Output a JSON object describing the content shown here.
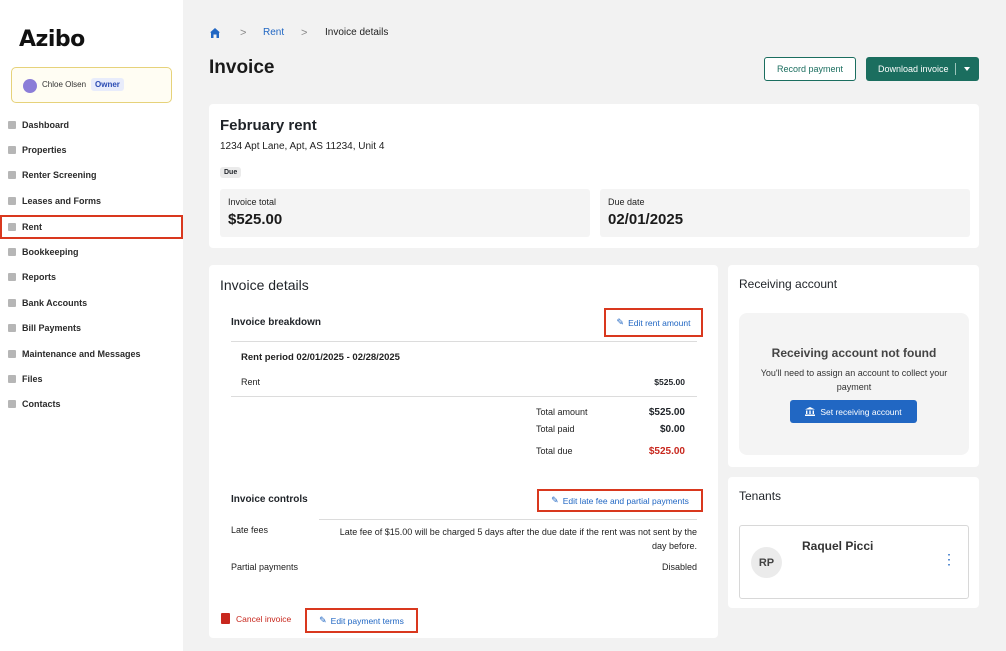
{
  "app": {
    "logo": "Azibo"
  },
  "user": {
    "name": "Chloe Olsen",
    "role": "Owner"
  },
  "sidebar": {
    "items": [
      {
        "label": "Dashboard",
        "icon": "home-icon"
      },
      {
        "label": "Properties",
        "icon": "building-icon"
      },
      {
        "label": "Renter Screening",
        "icon": "screening-icon"
      },
      {
        "label": "Leases and Forms",
        "icon": "document-icon"
      },
      {
        "label": "Rent",
        "icon": "rent-icon"
      },
      {
        "label": "Bookkeeping",
        "icon": "ledger-icon"
      },
      {
        "label": "Reports",
        "icon": "report-icon"
      },
      {
        "label": "Bank Accounts",
        "icon": "bank-icon"
      },
      {
        "label": "Bill Payments",
        "icon": "bill-icon"
      },
      {
        "label": "Maintenance and Messages",
        "icon": "tools-icon"
      },
      {
        "label": "Files",
        "icon": "folder-icon"
      },
      {
        "label": "Contacts",
        "icon": "contacts-icon"
      }
    ]
  },
  "breadcrumb": {
    "link": "Rent",
    "current": "Invoice details",
    "sep": ">"
  },
  "header": {
    "title": "Invoice",
    "record_payment": "Record payment",
    "download_invoice": "Download invoice"
  },
  "invoice": {
    "title": "February rent",
    "address": "1234 Apt Lane, Apt, AS 11234, Unit 4",
    "status": "Due",
    "total_label": "Invoice total",
    "total_value": "$525.00",
    "due_label": "Due date",
    "due_value": "02/01/2025"
  },
  "details": {
    "title": "Invoice details",
    "breakdown_title": "Invoice breakdown",
    "edit_rent": "Edit rent amount",
    "period": "Rent period 02/01/2025 - 02/28/2025",
    "rent_label": "Rent",
    "rent_value": "$525.00",
    "total_amount_label": "Total amount",
    "total_amount_value": "$525.00",
    "total_paid_label": "Total paid",
    "total_paid_value": "$0.00",
    "total_due_label": "Total due",
    "total_due_value": "$525.00",
    "controls_title": "Invoice controls",
    "edit_late_fee": "Edit late fee and partial payments",
    "late_fees_label": "Late fees",
    "late_fees_value": "Late fee of $15.00 will be charged 5 days after the due date if the rent was not sent by the day before.",
    "partial_label": "Partial payments",
    "partial_value": "Disabled",
    "cancel_invoice": "Cancel invoice",
    "edit_terms": "Edit payment terms"
  },
  "receiving": {
    "title": "Receiving account",
    "empty_title": "Receiving account not found",
    "empty_text": "You'll need to assign an account to collect your payment",
    "button": "Set receiving account"
  },
  "tenants": {
    "title": "Tenants",
    "list": [
      {
        "initials": "RP",
        "name": "Raquel Picci"
      }
    ]
  },
  "colors": {
    "accent": "#1b6e5f",
    "link": "#2167c3",
    "danger": "#c8281e",
    "highlight": "#d9381e"
  }
}
